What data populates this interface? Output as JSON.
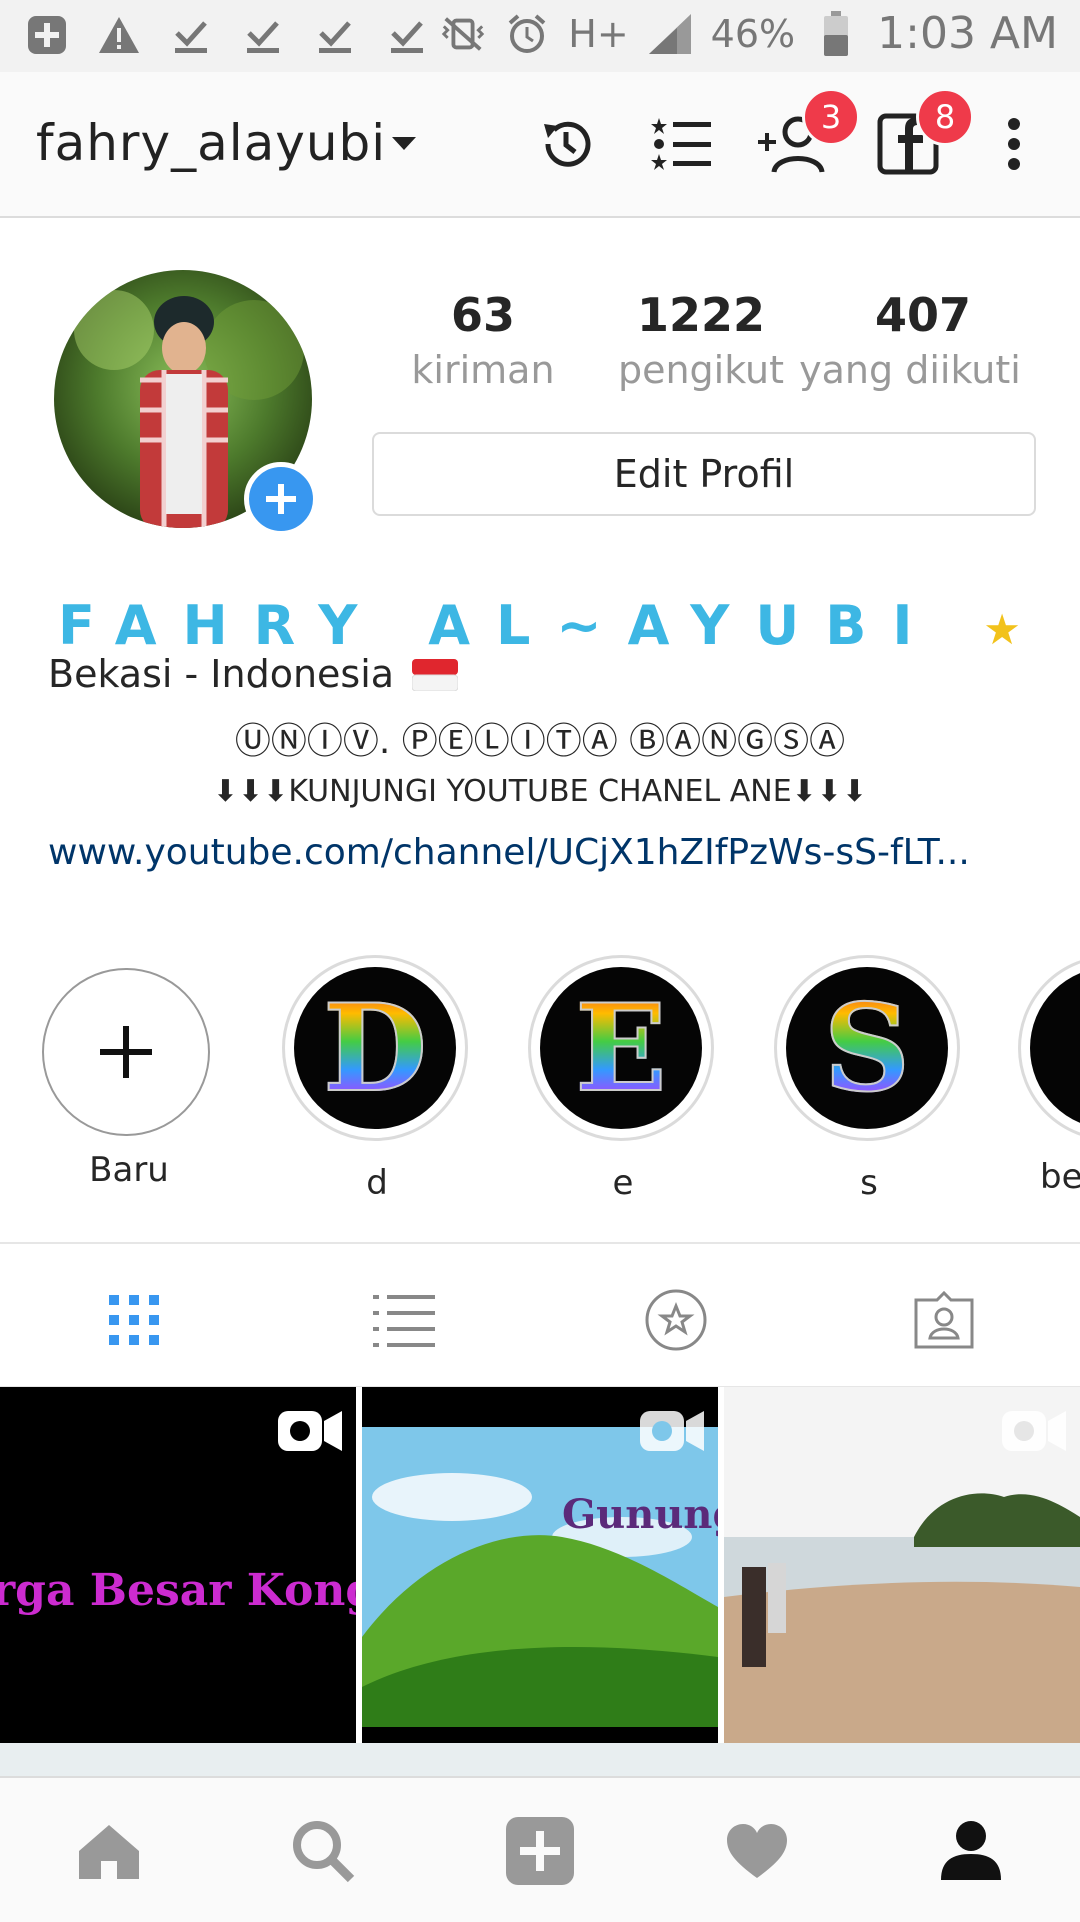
{
  "status_bar": {
    "network": "H+",
    "battery": "46%",
    "time": "1:03 AM"
  },
  "header": {
    "username": "fahry_alayubi",
    "friend_requests_badge": "3",
    "facebook_badge": "8"
  },
  "profile": {
    "stats": [
      {
        "value": "63",
        "label": "kiriman"
      },
      {
        "value": "1222",
        "label": "pengikut"
      },
      {
        "value": "407",
        "label": "yang diikuti"
      }
    ],
    "edit_label": "Edit Profil",
    "full_name": "FAHRY AL~AYUBI",
    "bio_location": "Bekasi - Indonesia",
    "bio_university": "ⓊⓃⒾⓋ. ⓅⒺⓁⒾⓉⒶ ⒷⒶⓃⒼⓈⒶ",
    "bio_youtube": "⬇⬇⬇KUNJUNGI YOUTUBE CHANEL ANE⬇⬇⬇",
    "website": "www.youtube.com/channel/UCjX1hZIfPzWs-sS-fLT..."
  },
  "highlights": [
    {
      "label": "Baru",
      "letter": ""
    },
    {
      "label": "d",
      "letter": "D"
    },
    {
      "label": "e",
      "letter": "E"
    },
    {
      "label": "s",
      "letter": "S"
    },
    {
      "label": "be",
      "letter": ""
    }
  ],
  "grid": [
    {
      "caption": "rga Besar Kong H",
      "type": "video"
    },
    {
      "caption": "Gunung",
      "type": "video"
    },
    {
      "caption": "",
      "type": "video"
    }
  ],
  "colors": {
    "accent": "#3897f0",
    "name": "#3db7e4",
    "badge": "#ef3a4a",
    "link": "#003569"
  }
}
